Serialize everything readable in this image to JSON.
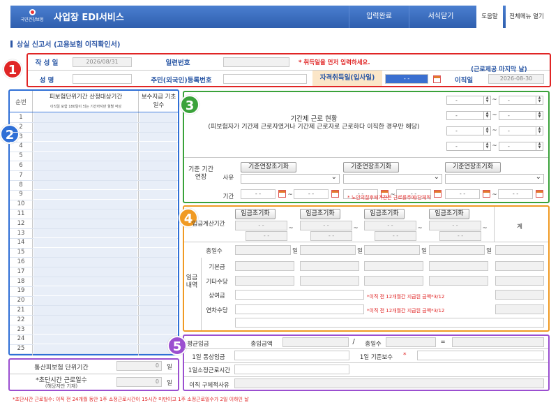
{
  "header": {
    "logo_text": "국민건강보험",
    "title": "사업장 EDI서비스",
    "menu": [
      "입력완료",
      "서식닫기"
    ],
    "menu_white": [
      "도움말",
      "전체메뉴 열기"
    ]
  },
  "page_title": "상실 신고서 (고용보험 이직확인서)",
  "badges": [
    "1",
    "2",
    "3",
    "4",
    "5"
  ],
  "s1": {
    "write_date_label": "작 성 일",
    "write_date": "2026/08/31",
    "serial_label": "일련번호",
    "warning": "* 취득일을 먼저 입력하세요.",
    "last_day_note": "(근로제공 마지막 날)",
    "name_label": "성      명",
    "rrn_label": "주민(외국인)등록번호",
    "acq_label": "자격취득일(입사일)",
    "acq_value": "- -",
    "leave_label": "이직일",
    "leave_value": "2026-08-30"
  },
  "s2": {
    "col_seq": "순번",
    "col_period": "피보험단위기간 산정대상기간",
    "col_period_sub": "이직일 포함 180일이 되는 기간까지만 월별 작성",
    "col_days": "보수지급 기초일수",
    "rows": [
      "1",
      "2",
      "3",
      "4",
      "5",
      "6",
      "7",
      "8",
      "9",
      "10",
      "11",
      "12",
      "13",
      "14",
      "15",
      "16",
      "17",
      "18",
      "19",
      "20",
      "21",
      "22",
      "23",
      "24",
      "25"
    ],
    "total_label": "통산피보험 단위기간",
    "total_val": "0",
    "total_unit": "일",
    "short_label": "*초단시간 근로일수",
    "short_sub": "(해당자만 기재)",
    "short_val": "0",
    "short_unit": "일"
  },
  "s3": {
    "title": "기간제 근로 현황",
    "sub": "(피보험자가 기간제 근로자였거나 기간제 근로자로 근로하다 이직한 경우만 해당)",
    "dash": "-",
    "tilde": "~",
    "ext_label": "기준 기간 연장",
    "reason_label": "사유",
    "period_label": "기간",
    "btn": "기준연장초기화",
    "date_dash": "- -",
    "note": "* 노인의질후에기간은 근로를주에/단체직"
  },
  "s4": {
    "btn": "임금초기화",
    "calc_label": "임금계산기간",
    "date_dash": "- -",
    "tilde": "~",
    "total_label": "계",
    "days_label": "총일수",
    "day_unit": "일",
    "wage_side": "임금내역",
    "rows": [
      "기본급",
      "기타수당",
      "상여금",
      "연차수당"
    ],
    "bonus_note": "*이직 전 12개월간 지급된 금액*3/12",
    "annual_note": "*이직 전 12개월간 지급된 금액*3/12"
  },
  "s5": {
    "avg_label": "평균임금",
    "total_wage_label": "총임금액",
    "slash": "/",
    "total_days_label": "총일수",
    "eq": "=",
    "daily_label": "1일 통상임금",
    "base_label": "1일 기준보수",
    "star": "*",
    "hours_label": "1일소정근로시간",
    "reason_label": "이직 구체적사유"
  },
  "footnote": "*초단시간 근로일수: 이직 전 24개월 동안 1주 소정근로시간이 15시간 미만이고 1주 소정근로일수가 2일 이하인 날",
  "colors": {
    "header": "#2f5fae",
    "red": "#e02525",
    "blue": "#2f6fd6",
    "green": "#3aa23a",
    "orange": "#f09a23",
    "purple": "#9b4fd0"
  }
}
